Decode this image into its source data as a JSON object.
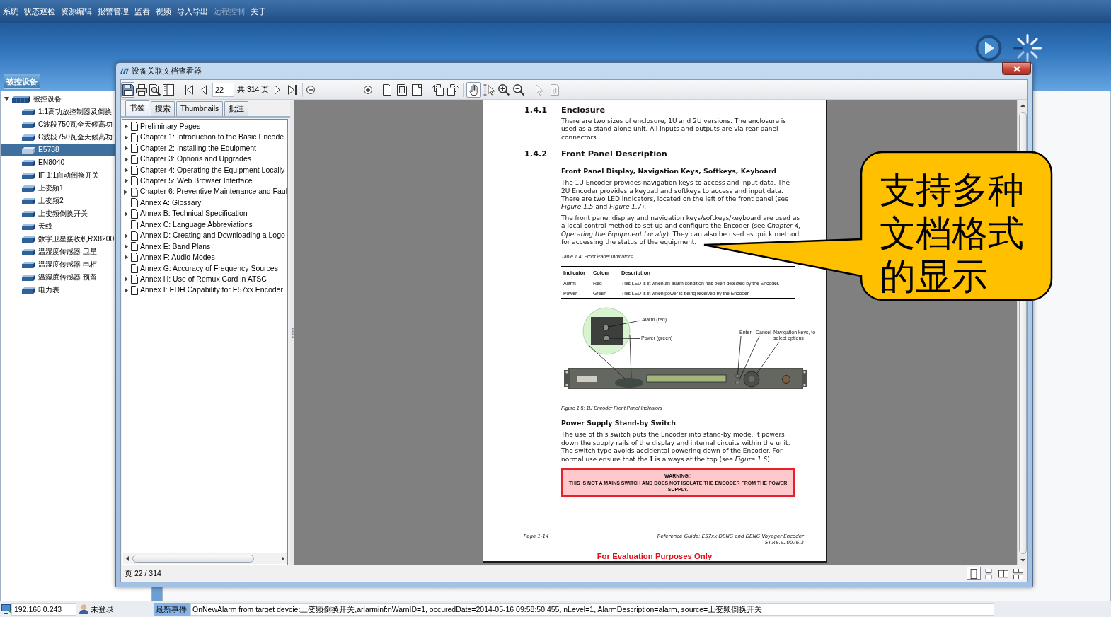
{
  "menu_bar": [
    {
      "label": "系统",
      "disabled": false
    },
    {
      "label": "状态巡检",
      "disabled": false
    },
    {
      "label": "资源编辑",
      "disabled": false
    },
    {
      "label": "报警管理",
      "disabled": false
    },
    {
      "label": "监看",
      "disabled": false
    },
    {
      "label": "视频",
      "disabled": false
    },
    {
      "label": "导入导出",
      "disabled": false
    },
    {
      "label": "远程控制",
      "disabled": true
    },
    {
      "label": "关于",
      "disabled": false
    }
  ],
  "side_tab": "被控设备",
  "device_tree": {
    "label": "被控设备",
    "expanded": true,
    "children": [
      {
        "label": "1:1高功放控制器及倒换",
        "selected": false
      },
      {
        "label": "C波段750瓦全天候高功",
        "selected": false
      },
      {
        "label": "C波段750瓦全天候高功",
        "selected": false
      },
      {
        "label": "E5788",
        "selected": true
      },
      {
        "label": "EN8040",
        "selected": false
      },
      {
        "label": "IF 1:1自动倒换开关",
        "selected": false
      },
      {
        "label": "上变频1",
        "selected": false
      },
      {
        "label": "上变频2",
        "selected": false
      },
      {
        "label": "上变频倒换开关",
        "selected": false
      },
      {
        "label": "天线",
        "selected": false
      },
      {
        "label": "数字卫星接收机RX8200",
        "selected": false
      },
      {
        "label": "温湿度传感器 卫星",
        "selected": false
      },
      {
        "label": "温湿度传感器 电柜",
        "selected": false
      },
      {
        "label": "温湿度传感器 预留",
        "selected": false
      },
      {
        "label": "电力表",
        "selected": false
      }
    ]
  },
  "viewer": {
    "title": "设备关联文档查看器",
    "toolbar": [
      {
        "items": [
          {
            "kind": "save",
            "pressed": true,
            "disabled": false
          },
          {
            "kind": "print",
            "pressed": false,
            "disabled": false
          },
          {
            "kind": "preview",
            "pressed": false,
            "disabled": false
          },
          {
            "kind": "panel",
            "pressed": false,
            "disabled": false
          }
        ]
      },
      {
        "items": [
          {
            "kind": "first",
            "pressed": false,
            "disabled": false
          },
          {
            "kind": "prev",
            "pressed": false,
            "disabled": false
          },
          {
            "kind": "page-field",
            "value": "22"
          },
          {
            "kind": "page-count",
            "text": "共 314 页"
          },
          {
            "kind": "next",
            "pressed": false,
            "disabled": false
          },
          {
            "kind": "last",
            "pressed": false,
            "disabled": false
          }
        ]
      },
      {
        "items": [
          {
            "kind": "zoom-minus",
            "pressed": false,
            "disabled": false
          },
          {
            "kind": "zoom-plus",
            "pressed": false,
            "disabled": false
          }
        ]
      },
      {
        "items": [
          {
            "kind": "page-single",
            "pressed": false,
            "disabled": false
          },
          {
            "kind": "page-fit",
            "pressed": false,
            "disabled": false
          },
          {
            "kind": "page-width",
            "pressed": false,
            "disabled": false
          }
        ]
      },
      {
        "items": [
          {
            "kind": "rotate-left",
            "pressed": false,
            "disabled": false
          },
          {
            "kind": "rotate-right",
            "pressed": false,
            "disabled": false
          }
        ]
      },
      {
        "items": [
          {
            "kind": "hand",
            "pressed": true,
            "disabled": false
          },
          {
            "kind": "text-select",
            "pressed": false,
            "disabled": false
          },
          {
            "kind": "zoom-in",
            "pressed": false,
            "disabled": false
          },
          {
            "kind": "zoom-out",
            "pressed": false,
            "disabled": false
          }
        ]
      },
      {
        "items": [
          {
            "kind": "pointer",
            "pressed": false,
            "disabled": true
          },
          {
            "kind": "attach",
            "pressed": false,
            "disabled": true
          }
        ]
      }
    ],
    "tabs": [
      {
        "label": "书签",
        "selected": true
      },
      {
        "label": "搜索",
        "selected": false
      },
      {
        "label": "Thumbnails",
        "selected": false
      },
      {
        "label": "批注",
        "selected": false
      }
    ],
    "bookmarks": [
      {
        "label": "Preliminary Pages",
        "expandable": true
      },
      {
        "label": "Chapter 1: Introduction to the Basic Encode",
        "expandable": true
      },
      {
        "label": "Chapter 2: Installing the Equipment",
        "expandable": true
      },
      {
        "label": "Chapter 3: Options and Upgrades",
        "expandable": true
      },
      {
        "label": "Chapter 4: Operating the Equipment Locally",
        "expandable": true
      },
      {
        "label": "Chapter 5: Web Browser Interface",
        "expandable": true
      },
      {
        "label": "Chapter 6: Preventive Maintenance and Faul",
        "expandable": true
      },
      {
        "label": "Annex A: Glossary",
        "expandable": false
      },
      {
        "label": "Annex B: Technical Specification",
        "expandable": true
      },
      {
        "label": "Annex C: Language Abbreviations",
        "expandable": false
      },
      {
        "label": "Annex D: Creating and Downloading a Logo",
        "expandable": true
      },
      {
        "label": "Annex E: Band Plans",
        "expandable": true
      },
      {
        "label": "Annex F: Audio Modes",
        "expandable": true
      },
      {
        "label": "Annex G: Accuracy of Frequency Sources",
        "expandable": false
      },
      {
        "label": "Annex H: Use of Remux Card in ATSC",
        "expandable": true
      },
      {
        "label": "Annex I: EDH Capability for E57xx Encoder",
        "expandable": true
      }
    ],
    "page": {
      "blocks": [
        {
          "kind": "heading",
          "number": "1.4.1",
          "text": "Enclosure"
        },
        {
          "kind": "paragraph",
          "text": "There are two sizes of enclosure, 1U and 2U versions. The enclosure is used as a stand-alone unit. All inputs and outputs are via rear panel connectors."
        },
        {
          "kind": "heading",
          "number": "1.4.2",
          "text": "Front Panel Description"
        },
        {
          "kind": "subheading",
          "text": "Front Panel Display, Navigation Keys, Softkeys, Keyboard"
        },
        {
          "kind": "paragraph",
          "text": "The 1U Encoder provides navigation keys to access and input data. The 2U Encoder provides a keypad and softkeys to access and input data. There are two LED indicators, located on the left of the front panel (see *Figure 1.5* and *Figure 1.7*)."
        },
        {
          "kind": "paragraph",
          "text": "The front panel display and navigation keys/softkeys/keyboard are used as a local control method to set up and configure the Encoder (see *Chapter 4, Operating the Equipment Locally*). They can also be used as quick method for accessing the status of the equipment."
        },
        {
          "kind": "caption",
          "text": "Table 1.4: Front Panel Indicators"
        },
        {
          "kind": "table",
          "columns": [
            "Indicator",
            "Colour",
            "Description"
          ],
          "rows": [
            [
              "Alarm",
              "Red",
              "This LED is lit when an alarm condition has been detected by the Encoder."
            ],
            [
              "Power",
              "Green",
              "This LED is lit when power is being received by the Encoder."
            ]
          ]
        },
        {
          "kind": "figure",
          "labels": [
            "Alarm (red)",
            "Power (green)",
            "Enter",
            "Cancel",
            "Navigation keys, to select options"
          ]
        },
        {
          "kind": "caption",
          "text": "Figure 1.5: 1U Encoder Front Panel Indicators"
        },
        {
          "kind": "subheading",
          "text": "Power Supply Stand-by Switch"
        },
        {
          "kind": "paragraph",
          "text": "The use of this switch puts the Encoder into stand-by mode. It powers down the supply rails of the display and internal circuits within the unit. The switch type avoids accidental powering-down of the Encoder. For normal use ensure that the **I** is always at the top (see *Figure 1.6*)."
        },
        {
          "kind": "warning",
          "title": "WARNING□",
          "text": "THIS IS NOT A MAINS SWITCH AND DOES NOT ISOLATE THE ENCODER FROM THE POWER SUPPLY."
        }
      ],
      "footer": {
        "left": "Page 1-14",
        "right": [
          "Reference Guide: E57xx DSNG and DENG Voyager Encoder",
          "ST.RE.E10076.3"
        ]
      },
      "evaluation_notice": "For Evaluation Purposes Only"
    },
    "page_status": "页 22 / 314",
    "view_modes": [
      {
        "kind": "single",
        "selected": true
      },
      {
        "kind": "continuous",
        "selected": false
      },
      {
        "kind": "facing",
        "selected": false
      },
      {
        "kind": "continuous-facing",
        "selected": false
      }
    ]
  },
  "callout": {
    "text": "支持多种文档格式的显示"
  },
  "status_bar": {
    "ip": "192.168.0.243",
    "user": "未登录",
    "event_label": "最新事件:",
    "event": "OnNewAlarm from target devcie:上变频倒换开关,arlarminf:nWarnID=1, occuredDate=2014-05-16 09:58:50:455, nLevel=1, AlarmDescription=alarm, source=上变频倒换开关"
  }
}
